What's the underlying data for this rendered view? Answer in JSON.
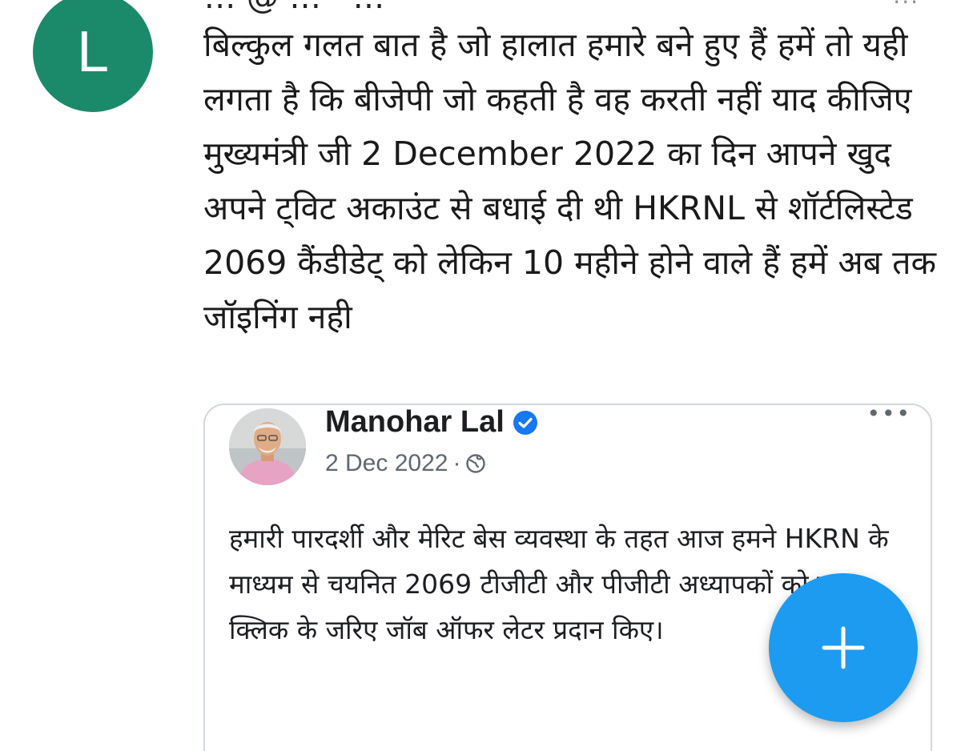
{
  "reply": {
    "author_initial": "L",
    "header_partial": "... @ ... · ...",
    "more_glyph": "···",
    "body": "बिल्कुल गलत बात है जो हालात हमारे बने हुए हैं हमें तो यही लगता है कि बीजेपी जो कहती है वह करती नहीं याद कीजिए मुख्यमंत्री जी 2 December 2022 का दिन आपने खुद अपने ट्विट अकाउंट से बधाई दी थी HKRNL से शॉर्टलिस्टेड 2069 कैंडीडेट् को लेकिन 10 महीने होने वाले हैं हमें अब तक जॉइनिंग नही"
  },
  "quoted_post": {
    "author_name": "Manohar Lal",
    "verified": true,
    "date": "2 Dec 2022",
    "separator": "·",
    "more_glyph": "•••",
    "body": "हमारी पारदर्शी और मेरिट बेस व्यवस्था के तहत आज हमने HKRN के माध्यम से चयनित 2069 टीजीटी और पीजीटी अध्यापकों को एक क्लिक के जरिए जॉब ऑफर लेटर प्रदान किए।"
  },
  "compose_button": {
    "icon": "plus-icon"
  },
  "colors": {
    "avatar_bg": "#1b8a6b",
    "fab": "#1d9bf0",
    "verified": "#1877f2",
    "card_border": "#d3d8dc",
    "meta_text": "#606770"
  }
}
